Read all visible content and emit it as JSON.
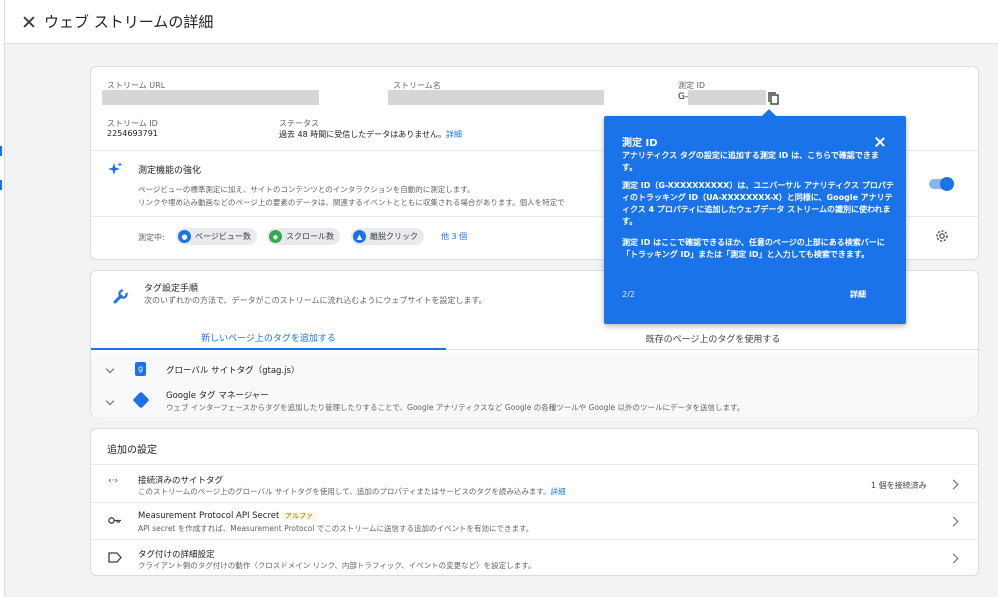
{
  "header": {
    "title": "ウェブ ストリームの詳細"
  },
  "stream": {
    "url_label": "ストリーム URL",
    "name_label": "ストリーム名",
    "measurement_id_label": "測定 ID",
    "measurement_id_prefix": "G-",
    "stream_id_label": "ストリーム ID",
    "stream_id_value": "2254693791",
    "status_label": "ステータス",
    "status_value": "過去 48 時間に受信したデータはありません。",
    "status_link": "詳細"
  },
  "enhanced": {
    "title": "測定機能の強化",
    "desc_line1": "ページビューの標準測定に加え、サイトのコンテンツとのインタラクションを自動的に測定します。",
    "desc_line2": "リンクや埋め込み動画などのページ上の要素のデータは、関連するイベントとともに収集される場合があります。個人を特定で",
    "measuring_label": "測定中:",
    "chips": [
      {
        "label": "ページビュー数",
        "icon": "eye-icon",
        "color": "#1a73e8"
      },
      {
        "label": "スクロール数",
        "icon": "scroll-icon",
        "color": "#34a853"
      },
      {
        "label": "離脱クリック",
        "icon": "cursor-icon",
        "color": "#1a73e8"
      }
    ],
    "more_link": "他 3 個"
  },
  "tag_setup": {
    "title": "タグ設定手順",
    "desc": "次のいずれかの方法で、データがこのストリームに流れ込むようにウェブサイトを設定します。",
    "tab_new": "新しいページ上のタグを追加する",
    "tab_existing": "既存のページ上のタグを使用する",
    "gtag_title": "グローバル サイトタグ（gtag.js）",
    "gtm_title": "Google タグ マネージャー",
    "gtm_desc": "ウェブ インターフェースからタグを追加したり管理したりすることで、Google アナリティクスなど Google の各種ツールや Google 以外のツールにデータを送信します。"
  },
  "additional": {
    "title": "追加の設定",
    "rows": [
      {
        "title": "接続済みのサイトタグ",
        "desc": "このストリームのページ上のグローバル サイトタグを使用して、追加のプロパティまたはサービスのタグを読み込みます。",
        "link": "詳細",
        "right": "1 個を接続済み",
        "icon": "code-icon"
      },
      {
        "title": "Measurement Protocol API Secret",
        "badge": "アルファ",
        "desc": "API secret を作成すれば、Measurement Protocol でこのストリームに送信する追加のイベントを有効にできます。",
        "icon": "key-icon"
      },
      {
        "title": "タグ付けの詳細設定",
        "desc": "クライアント側のタグ付けの動作（クロスドメイン リンク、内部トラフィック、イベントの変更など）を設定します。",
        "icon": "label-icon"
      }
    ]
  },
  "tooltip": {
    "title": "測定 ID",
    "p1": "アナリティクス タグの設定に追加する測定 ID は、こちらで確認できます。",
    "p2": "測定 ID（G-XXXXXXXXXX）は、ユニバーサル アナリティクス プロパティのトラッキング ID（UA-XXXXXXXX-X）と同様に、Google アナリティクス 4 プロパティに追加したウェブデータ ストリームの識別に使われます。",
    "p3": "測定 ID はここで確認できるほか、任意のページの上部にある検索バーに「トラッキング ID」または「測定 ID」と入力しても検索できます。",
    "step": "2/2",
    "more": "詳細"
  }
}
